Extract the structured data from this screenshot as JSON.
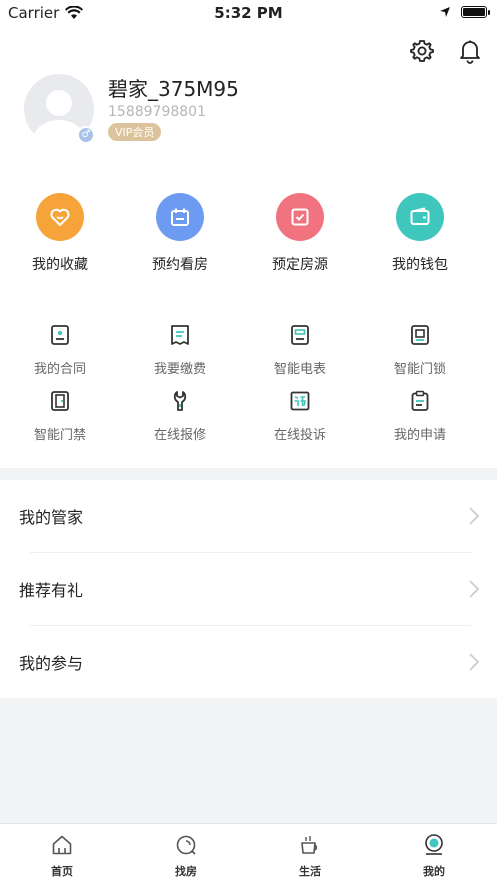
{
  "status": {
    "carrier": "Carrier",
    "time": "5:32 PM",
    "battery_level": 1.0
  },
  "header": {
    "settings_icon": "gear-icon",
    "notification_icon": "bell-icon"
  },
  "profile": {
    "username": "碧家_375M95",
    "phone": "15889798801",
    "badge": "VIP会员",
    "gender_symbol": "♂"
  },
  "main_actions": [
    {
      "label": "我的收藏",
      "icon": "heart-icon",
      "color": "#f6a43a"
    },
    {
      "label": "预约看房",
      "icon": "calendar-icon",
      "color": "#6e9bf2"
    },
    {
      "label": "预定房源",
      "icon": "check-icon",
      "color": "#f0737f"
    },
    {
      "label": "我的钱包",
      "icon": "wallet-icon",
      "color": "#3fc6bd"
    }
  ],
  "services": [
    {
      "label": "我的合同",
      "icon": "contract-icon"
    },
    {
      "label": "我要缴费",
      "icon": "bill-icon"
    },
    {
      "label": "智能电表",
      "icon": "meter-icon"
    },
    {
      "label": "智能门锁",
      "icon": "lock-icon"
    },
    {
      "label": "智能门禁",
      "icon": "door-icon"
    },
    {
      "label": "在线报修",
      "icon": "wrench-icon"
    },
    {
      "label": "在线投诉",
      "icon": "complaint-icon"
    },
    {
      "label": "我的申请",
      "icon": "clipboard-icon"
    }
  ],
  "menu": [
    {
      "label": "我的管家"
    },
    {
      "label": "推荐有礼"
    },
    {
      "label": "我的参与"
    }
  ],
  "tabs": [
    {
      "label": "首页",
      "icon": "home-icon"
    },
    {
      "label": "找房",
      "icon": "search-house-icon"
    },
    {
      "label": "生活",
      "icon": "cup-icon"
    },
    {
      "label": "我的",
      "icon": "profile-icon",
      "active": true
    }
  ],
  "colors": {
    "accent": "#3fc6bd",
    "vip": "#dcc39b",
    "icon_dark": "#333333"
  }
}
